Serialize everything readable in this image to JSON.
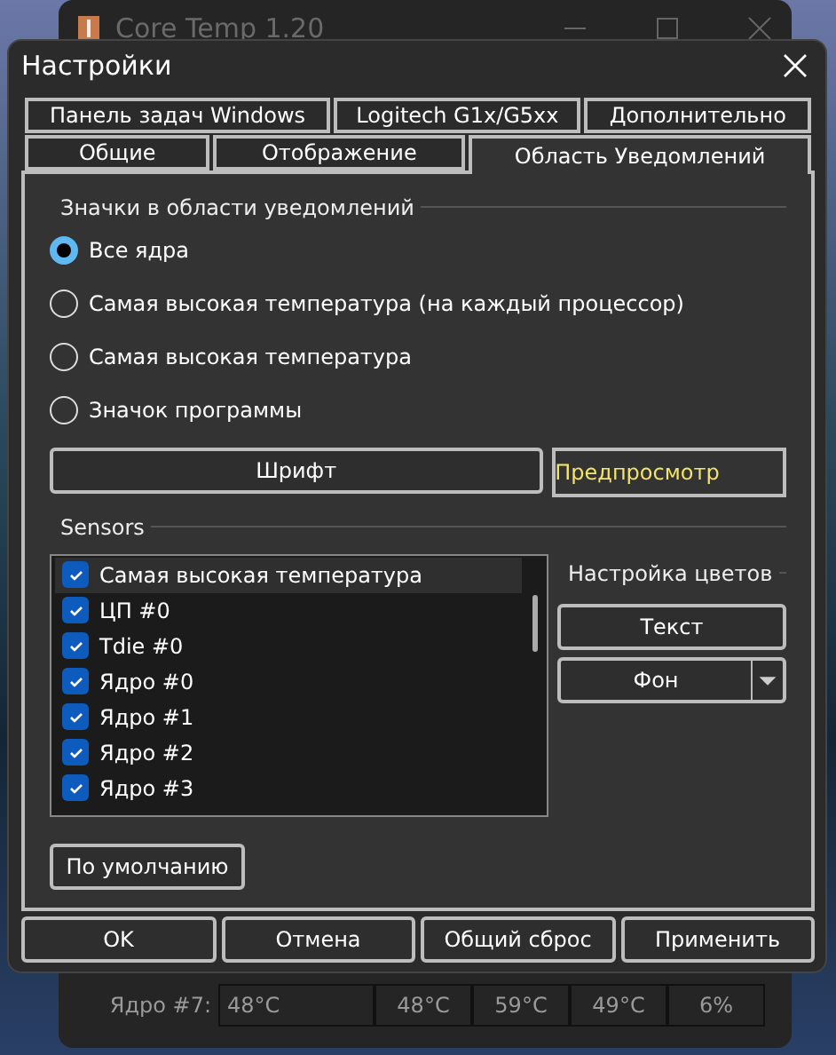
{
  "background_window": {
    "title": "Core Temp 1.20",
    "rows": [
      {
        "label": "Ядро #7:",
        "cells": [
          "48°C",
          "48°C",
          "59°C",
          "49°C",
          "6%"
        ]
      }
    ]
  },
  "dialog": {
    "title": "Настройки",
    "tab_rows": [
      [
        {
          "label": "Панель задач Windows",
          "selected": false
        },
        {
          "label": "Logitech G1x/G5xx",
          "selected": false
        },
        {
          "label": "Дополнительно",
          "selected": false
        }
      ],
      [
        {
          "label": "Общие",
          "selected": false
        },
        {
          "label": "Отображение",
          "selected": false
        },
        {
          "label": "Область Уведомлений",
          "selected": true
        }
      ]
    ],
    "tray_group": {
      "legend": "Значки в области уведомлений",
      "options": [
        {
          "label": "Все ядра",
          "selected": true
        },
        {
          "label": "Самая высокая температура (на каждый процессор)",
          "selected": false
        },
        {
          "label": "Самая высокая температура",
          "selected": false
        },
        {
          "label": "Значок программы",
          "selected": false
        }
      ]
    },
    "font_button": "Шрифт",
    "preview": "Предпросмотр",
    "sensors": {
      "legend": "Sensors",
      "items": [
        {
          "label": "Самая высокая температура",
          "checked": true,
          "selected": true
        },
        {
          "label": "ЦП #0",
          "checked": true,
          "selected": false
        },
        {
          "label": "Tdie #0",
          "checked": true,
          "selected": false
        },
        {
          "label": "Ядро #0",
          "checked": true,
          "selected": false
        },
        {
          "label": "Ядро #1",
          "checked": true,
          "selected": false
        },
        {
          "label": "Ядро #2",
          "checked": true,
          "selected": false
        },
        {
          "label": "Ядро #3",
          "checked": true,
          "selected": false
        }
      ]
    },
    "colors": {
      "legend": "Настройка цветов",
      "text_button": "Текст",
      "background_button": "Фон"
    },
    "defaults_button": "По умолчанию",
    "buttons": [
      "OK",
      "Отмена",
      "Общий сброс",
      "Применить"
    ]
  }
}
